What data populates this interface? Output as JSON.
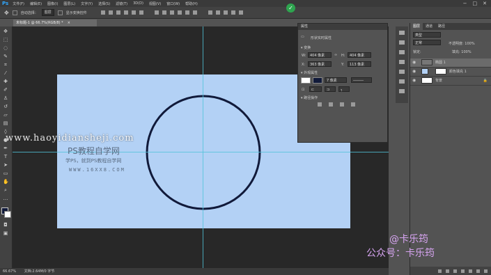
{
  "app": {
    "logo": "Ps",
    "window_controls": [
      "−",
      "□",
      "✕"
    ]
  },
  "menu": [
    "文件(F)",
    "编辑(E)",
    "图像(I)",
    "图层(L)",
    "文字(Y)",
    "选择(S)",
    "滤镜(T)",
    "3D(D)",
    "视图(V)",
    "窗口(W)",
    "帮助(H)"
  ],
  "options": {
    "auto_select_label": "自动选择：",
    "auto_select_value": "图层",
    "transform_label": "显示变换控件",
    "notification": "✓"
  },
  "document": {
    "tab_title": "未标题-1 @ 66.7%(RGB/8) *",
    "close": "×"
  },
  "status": {
    "zoom": "66.67%",
    "info": "文档:2.64M/0 字节"
  },
  "properties": {
    "tabs": "属性",
    "title": "形状实时属性",
    "section_transform": "变换",
    "w_label": "W:",
    "w_value": "404 像素",
    "h_label": "H:",
    "h_value": "404 像素",
    "x_label": "X:",
    "x_value": "363 像素",
    "y_label": "Y:",
    "y_value": "113 像素",
    "section_appearance": "外观属性",
    "stroke_width": "7 像素",
    "section_path": "路径操作",
    "colors": {
      "fill": "#ffffff",
      "stroke": "#111a3a"
    }
  },
  "layers": {
    "tabs": [
      "图层",
      "通道",
      "路径"
    ],
    "filter_label": "类型",
    "mode": "正常",
    "opacity_label": "不透明度: 100%",
    "lock_label": "锁定:",
    "fill_label": "填充: 100%",
    "items": [
      {
        "name": "椭圆 1"
      },
      {
        "name": "颜色填充 1"
      },
      {
        "name": "背景"
      }
    ]
  },
  "watermarks": {
    "site": "www.haoyidiansheji.com",
    "line1": "PS教程自学网",
    "line2": "学PS，就到PS教程自学网",
    "line3": "WWW.16XX8.COM",
    "brand1": "@卡乐筠",
    "brand2": "公众号：卡乐筠"
  },
  "canvas": {
    "background": "#b3d1f5",
    "circle_stroke": "#111a3a"
  }
}
